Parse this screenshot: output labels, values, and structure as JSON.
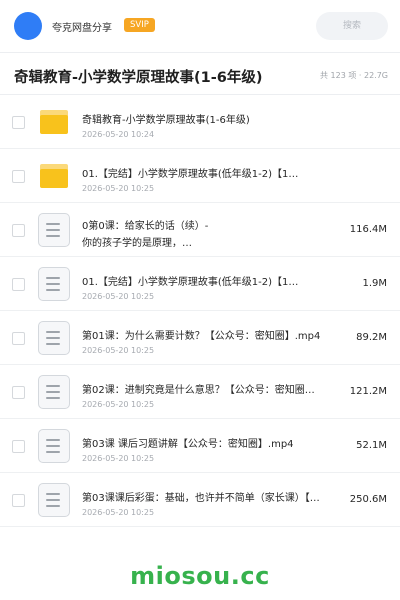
{
  "header": {
    "user_name": "夸克网盘分享",
    "badge": "SVIP",
    "search_placeholder": "搜索"
  },
  "folder": {
    "title": "奇辑教育-小学数学原理故事(1-6年级)",
    "meta": "共 123 项 · 22.7G"
  },
  "items": [
    {
      "kind": "folder",
      "name": "奇辑教育-小学数学原理故事(1-6年级)",
      "date": "2026-05-20 10:24",
      "size": ""
    },
    {
      "kind": "folder",
      "name": "01.【完结】小学数学原理故事(低年级1-2)【1…",
      "date": "2026-05-20 10:25",
      "size": ""
    },
    {
      "kind": "file",
      "name": "0第0课：给家长的话（续）-",
      "name_line2": "你的孩子学的是原理，…",
      "date": "",
      "size": "116.4M"
    },
    {
      "kind": "file",
      "name": "01.【完结】小学数学原理故事(低年级1-2)【1…",
      "date": "2026-05-20 10:25",
      "size": "1.9M"
    },
    {
      "kind": "file",
      "name": "第01课：为什么需要计数？【公众号：密知圈】.mp4",
      "date": "2026-05-20 10:25",
      "size": "89.2M"
    },
    {
      "kind": "file",
      "name": "第02课：进制究竟是什么意思？【公众号：密知圈】.…",
      "date": "2026-05-20 10:25",
      "size": "121.2M"
    },
    {
      "kind": "file",
      "name": "第03课 课后习题讲解【公众号：密知圈】.mp4",
      "date": "2026-05-20 10:25",
      "size": "52.1M"
    },
    {
      "kind": "file",
      "name": "第03课课后彩蛋：基础，也许并不简单（家长课）【公…",
      "date": "2026-05-20 10:25",
      "size": "250.6M"
    }
  ],
  "watermark": "miosou.cc",
  "colors": {
    "accent_blue": "#2f7df6",
    "svip_orange": "#f6a623",
    "folder_yellow": "#f8c21c",
    "watermark_green": "#37b24d"
  }
}
